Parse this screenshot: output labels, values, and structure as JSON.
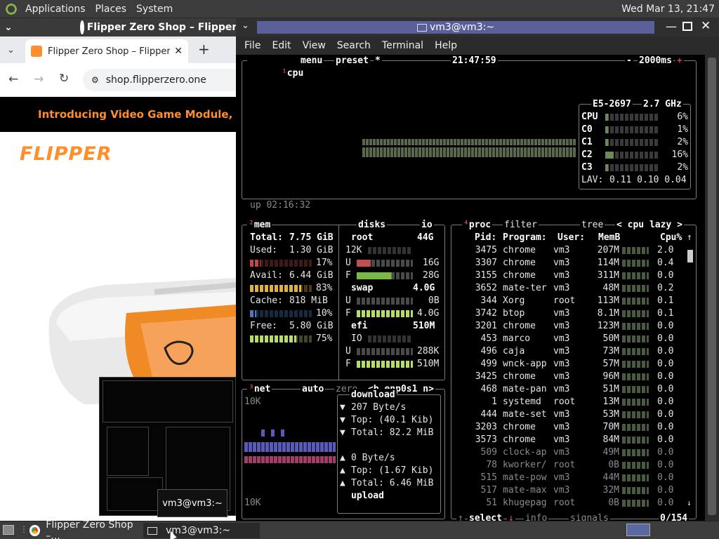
{
  "toppanel": {
    "menus": [
      "Applications",
      "Places",
      "System"
    ],
    "clock": "Wed Mar 13, 21:47"
  },
  "chrome": {
    "window_title": "Flipper Zero Shop – Flipper Shop",
    "tab_title": "Flipper Zero Shop – Flipper Sh",
    "new_tab": "+",
    "url": "shop.flipperzero.one",
    "banner": "Introducing Video Game Module, Powe",
    "logo_text": "FLIPPER"
  },
  "terminal": {
    "window_title": "vm3@vm3:~",
    "menus": [
      "File",
      "Edit",
      "View",
      "Search",
      "Terminal",
      "Help"
    ]
  },
  "btop": {
    "cpu_box": {
      "num": "¹",
      "title": "cpu",
      "menu": "menu",
      "preset": "preset",
      "star": "*",
      "time": "21:47:59",
      "minus": "-",
      "interval": "2000ms",
      "plus": "+",
      "uptime": "up 02:16:32"
    },
    "cpu_info": {
      "model": "E5-2697",
      "freq": "2.7 GHz",
      "rows": [
        {
          "label": "CPU",
          "pct": "6%",
          "level": 0.06
        },
        {
          "label": "C0",
          "pct": "1%",
          "level": 0.01
        },
        {
          "label": "C1",
          "pct": "2%",
          "level": 0.02
        },
        {
          "label": "C2",
          "pct": "16%",
          "level": 0.16
        },
        {
          "label": "C3",
          "pct": "2%",
          "level": 0.02
        }
      ],
      "lav_label": "LAV:",
      "lav": "0.11 0.10 0.04"
    },
    "mem": {
      "num": "²",
      "title": "mem",
      "total_label": "Total:",
      "total": "7.75 GiB",
      "used_label": "Used:",
      "used": "1.30 GiB",
      "used_pct": "17%",
      "used_level": 0.17,
      "avail_label": "Avail:",
      "avail": "6.44 GiB",
      "avail_pct": "83%",
      "avail_level": 0.83,
      "cache_label": "Cache:",
      "cache": "818 MiB",
      "cache_pct": "10%",
      "cache_level": 0.1,
      "free_label": "Free:",
      "free": "5.80 GiB",
      "free_pct": "75%",
      "free_level": 0.75
    },
    "disks": {
      "title": "disks",
      "io": "io",
      "root_label": "root",
      "root_size": "44G",
      "root_io": "12K",
      "root_used": "16G",
      "root_free": "28G",
      "swap_label": "swap",
      "swap_size": "4.0G",
      "swap_used": "0B",
      "swap_free": "4.0G",
      "efi_label": "efi",
      "efi_size": "510M",
      "efi_io": "IO",
      "efi_used": "288K",
      "efi_free": "510M",
      "u": "U",
      "f": "F"
    },
    "net": {
      "num": "³",
      "title": "net",
      "auto": "auto",
      "zero": "zero",
      "iface": "<b enp0s1 n>",
      "scale_top": "10K",
      "scale_bottom": "10K",
      "download": "download",
      "dl_rate": "207 Byte/s",
      "dl_top": "Top: (40.1 Kib)",
      "dl_total": "Total: 82.2 MiB",
      "upload": "upload",
      "ul_rate": "0 Byte/s",
      "ul_top": "Top: (1.67 Kib)",
      "ul_total": "Total: 6.46 MiB"
    },
    "proc": {
      "num": "⁴",
      "title": "proc",
      "filter": "filter",
      "tree": "tree",
      "sort": "< cpu lazy >",
      "headers": {
        "pid": "Pid:",
        "program": "Program:",
        "user": "User:",
        "mem": "MemB",
        "cpu": "Cpu%"
      },
      "rows": [
        {
          "pid": "3475",
          "prog": "chrome",
          "user": "vm3",
          "mem": "207M",
          "cpu": "2.0"
        },
        {
          "pid": "3307",
          "prog": "chrome",
          "user": "vm3",
          "mem": "114M",
          "cpu": "0.4"
        },
        {
          "pid": "3155",
          "prog": "chrome",
          "user": "vm3",
          "mem": "311M",
          "cpu": "0.0"
        },
        {
          "pid": "3652",
          "prog": "mate-ter",
          "user": "vm3",
          "mem": "48M",
          "cpu": "0.2"
        },
        {
          "pid": "344",
          "prog": "Xorg",
          "user": "root",
          "mem": "113M",
          "cpu": "0.1"
        },
        {
          "pid": "3742",
          "prog": "btop",
          "user": "vm3",
          "mem": "8.1M",
          "cpu": "0.1"
        },
        {
          "pid": "3201",
          "prog": "chrome",
          "user": "vm3",
          "mem": "123M",
          "cpu": "0.0"
        },
        {
          "pid": "453",
          "prog": "marco",
          "user": "vm3",
          "mem": "50M",
          "cpu": "0.0"
        },
        {
          "pid": "496",
          "prog": "caja",
          "user": "vm3",
          "mem": "73M",
          "cpu": "0.0"
        },
        {
          "pid": "499",
          "prog": "wnck-app",
          "user": "vm3",
          "mem": "57M",
          "cpu": "0.0"
        },
        {
          "pid": "3425",
          "prog": "chrome",
          "user": "vm3",
          "mem": "96M",
          "cpu": "0.0"
        },
        {
          "pid": "468",
          "prog": "mate-pan",
          "user": "vm3",
          "mem": "51M",
          "cpu": "0.0"
        },
        {
          "pid": "1",
          "prog": "systemd",
          "user": "root",
          "mem": "13M",
          "cpu": "0.0"
        },
        {
          "pid": "444",
          "prog": "mate-set",
          "user": "vm3",
          "mem": "53M",
          "cpu": "0.0"
        },
        {
          "pid": "3203",
          "prog": "chrome",
          "user": "vm3",
          "mem": "70M",
          "cpu": "0.0"
        },
        {
          "pid": "3573",
          "prog": "chrome",
          "user": "vm3",
          "mem": "84M",
          "cpu": "0.0"
        },
        {
          "pid": "509",
          "prog": "clock-ap",
          "user": "vm3",
          "mem": "49M",
          "cpu": "0.0"
        },
        {
          "pid": "78",
          "prog": "kworker/",
          "user": "root",
          "mem": "0B",
          "cpu": "0.0"
        },
        {
          "pid": "515",
          "prog": "mate-pow",
          "user": "vm3",
          "mem": "44M",
          "cpu": "0.0"
        },
        {
          "pid": "517",
          "prog": "mate-max",
          "user": "vm3",
          "mem": "32M",
          "cpu": "0.0"
        },
        {
          "pid": "51",
          "prog": "khugepag",
          "user": "root",
          "mem": "0B",
          "cpu": "0.0"
        }
      ],
      "footer_select": "select",
      "footer_info": "info",
      "footer_signals": "signals",
      "footer_count": "0/154"
    }
  },
  "taskbar": {
    "chrome_task": "Flipper Zero Shop –...",
    "term_task": "vm3@vm3:~",
    "tooltip": "vm3@vm3:~"
  },
  "colors": {
    "accent": "#ff8e2b",
    "btop_red": "#f25c5c",
    "terminal_title": "#5a5f99"
  }
}
